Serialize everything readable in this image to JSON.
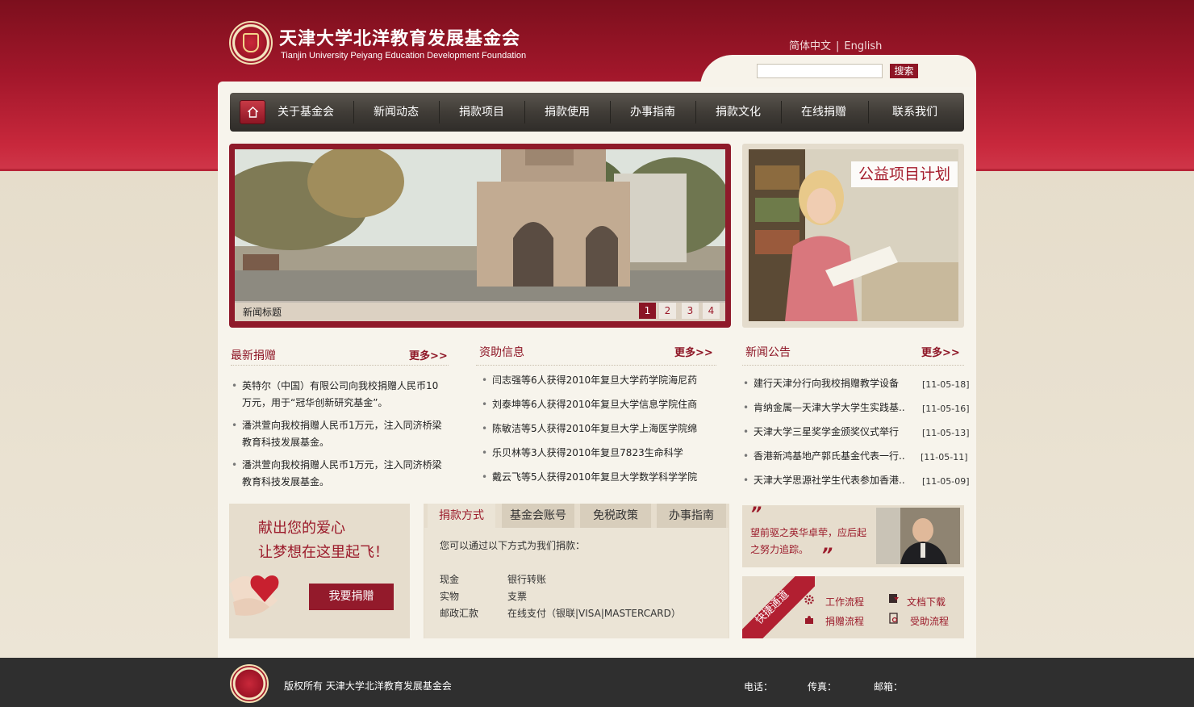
{
  "header": {
    "title": "天津大学北洋教育发展基金会",
    "subtitle": "Tianjin University Peiyang Education Development Foundation",
    "lang_cn": "简体中文",
    "lang_sep": "|",
    "lang_en": "English",
    "search_button": "搜索",
    "search_placeholder": ""
  },
  "nav": {
    "items": [
      "关于基金会",
      "新闻动态",
      "捐款项目",
      "捐款使用",
      "办事指南",
      "捐款文化",
      "在线捐赠",
      "联系我们"
    ]
  },
  "slider": {
    "caption": "新闻标题",
    "pages": [
      "1",
      "2",
      "3",
      "4"
    ],
    "active_page": "1"
  },
  "promo": {
    "label": "公益项目计划"
  },
  "latest_donations": {
    "title": "最新捐赠",
    "more": "更多>>",
    "items": [
      "英特尔（中国）有限公司向我校捐赠人民币10万元，用于“冠华创新研究基金”。",
      "潘洪萱向我校捐赠人民币1万元，注入同济桥梁教育科技发展基金。",
      "潘洪萱向我校捐赠人民币1万元，注入同济桥梁教育科技发展基金。"
    ]
  },
  "funding_info": {
    "title": "资助信息",
    "more": "更多>>",
    "items": [
      "闫志强等6人获得2010年复旦大学药学院海尼药",
      "刘泰坤等6人获得2010年复旦大学信息学院住商",
      "陈敏洁等5人获得2010年复旦大学上海医学院绵",
      "乐贝林等3人获得2010年复旦7823生命科学",
      "戴云飞等5人获得2010年复旦大学数学科学学院"
    ]
  },
  "news": {
    "title": "新闻公告",
    "more": "更多>>",
    "items": [
      {
        "text": "建行天津分行向我校捐赠教学设备",
        "date": "[11-05-18]"
      },
      {
        "text": "肯纳金属—天津大学大学生实践基..",
        "date": "[11-05-16]"
      },
      {
        "text": "天津大学三星奖学金颁奖仪式举行",
        "date": "[11-05-13]"
      },
      {
        "text": "香港新鸿基地产郭氏基金代表一行..",
        "date": "[11-05-11]"
      },
      {
        "text": "天津大学思源社学生代表参加香港..",
        "date": "[11-05-09]"
      }
    ]
  },
  "donate": {
    "line1": "献出您的爱心",
    "line2": "让梦想在这里起飞！",
    "button": "我要捐赠"
  },
  "tabs": {
    "labels": [
      "捐款方式",
      "基金会账号",
      "免税政策",
      "办事指南"
    ],
    "intro": "您可以通过以下方式为我们捐款：",
    "rows": [
      {
        "k": "现金",
        "v": "银行转账"
      },
      {
        "k": "实物",
        "v": "支票"
      },
      {
        "k": "邮政汇款",
        "v": "在线支付（银联|VISA|MASTERCARD）"
      }
    ]
  },
  "quote": {
    "open": "”",
    "text": "望前驱之英华卓荦，应后起之努力追踪。",
    "close": "”"
  },
  "quick": {
    "label": "快捷通道",
    "links": [
      "工作流程",
      "文档下载",
      "捐赠流程",
      "受助流程"
    ]
  },
  "footer": {
    "copyright": "版权所有 天津大学北洋教育发展基金会",
    "phone": "电话：",
    "fax": "传真：",
    "email": "邮箱："
  },
  "colors": {
    "brand": "#8e1626",
    "nav": "#403c37",
    "panel": "#f7f4ec"
  }
}
